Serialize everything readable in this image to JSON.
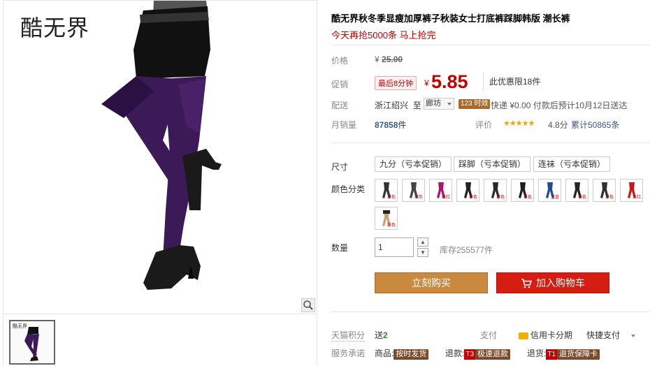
{
  "gallery": {
    "brand": "酷无界",
    "thumb_brand": "酷无界"
  },
  "product": {
    "title": "酷无界秋冬季显瘦加厚裤子秋装女士打底裤踩脚韩版 潮长裤",
    "subtitle": "今天再抢5000条 马上抢完"
  },
  "price": {
    "label": "价格",
    "currency": "¥",
    "original": "25.00"
  },
  "promo": {
    "label": "促销",
    "badge": "最后8分钟",
    "currency": "¥",
    "value": "5.85",
    "note": "此优惠限18件"
  },
  "shipping": {
    "label": "配送",
    "from": "浙江绍兴",
    "to_word": "至",
    "destination": "廊坊",
    "eta_badge": "123 时效",
    "detail": "快递 ¥0.00 付款后预计10月12日送达"
  },
  "sales": {
    "label": "月销量",
    "count": "87858",
    "unit": "件",
    "rating_label": "评价",
    "stars": "★★★★★",
    "score": "4.8分",
    "cumulative": "累计50865条"
  },
  "options": {
    "size_label": "尺寸",
    "sizes": [
      "九分（亏本促销）",
      "踩脚（亏本促销）",
      "连袜（亏本促销）"
    ],
    "color_label": "颜色分类",
    "colors": [
      {
        "name": "graphite",
        "tone": "#333333",
        "tag": "黑色"
      },
      {
        "name": "dark-grey",
        "tone": "#444444",
        "tag": "深灰"
      },
      {
        "name": "fuchsia",
        "tone": "#b0156a",
        "tag": "玫红"
      },
      {
        "name": "black-1",
        "tone": "#222222",
        "tag": "黑色"
      },
      {
        "name": "black-2",
        "tone": "#2a2a2a",
        "tag": "黑色"
      },
      {
        "name": "black-3",
        "tone": "#1e1e1e",
        "tag": "黑色"
      },
      {
        "name": "blue",
        "tone": "#1f4c9a",
        "tag": "宝蓝"
      },
      {
        "name": "black-4",
        "tone": "#252525",
        "tag": "黑色"
      },
      {
        "name": "black-5",
        "tone": "#303030",
        "tag": "黑色"
      },
      {
        "name": "red",
        "tone": "#c8161d",
        "tag": "大红"
      },
      {
        "name": "skin",
        "tone": "#c9a27c",
        "tag": "肤色"
      }
    ],
    "qty_label": "数量",
    "qty_value": "1",
    "qty_up": "▲",
    "qty_down": "▼",
    "stock": "库存255577件"
  },
  "actions": {
    "buy_now": "立刻购买",
    "add_cart": "加入购物车"
  },
  "services": {
    "points_label": "天猫积分",
    "points_text": "送",
    "points_value": "2",
    "pay_label": "支付",
    "credit": "信用卡分期",
    "quick_pay": "快捷支付",
    "promise_label": "服务承诺",
    "goods_prefix": "商品:",
    "goods_tag": "按时发货",
    "refund_prefix": "退款:",
    "refund_t": "T3",
    "refund_tag": "极速退款",
    "return_prefix": "退货:",
    "return_t": "T1",
    "return_tag": "退货保障卡"
  },
  "colors": {
    "price_red": "#c40000",
    "buy_now_bg": "#c98a3f",
    "add_cart_bg": "#d61d12",
    "link_blue": "#3a5a8c"
  }
}
